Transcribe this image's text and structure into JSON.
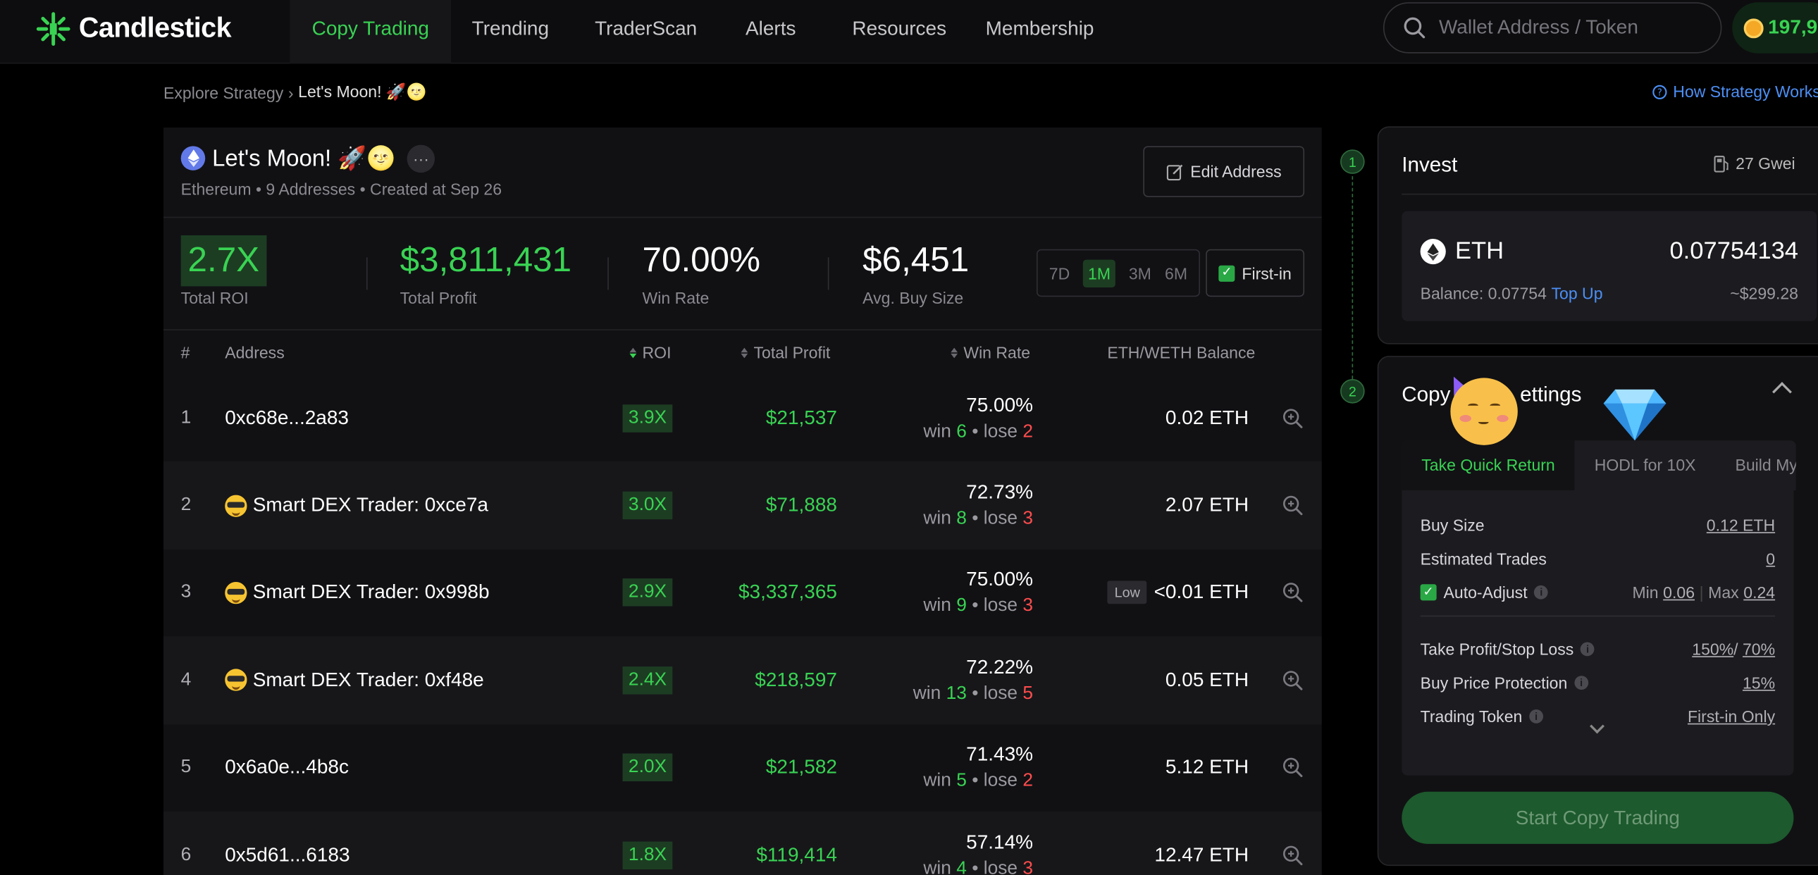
{
  "nav": {
    "logo": "Candlestick",
    "items": [
      "Copy Trading",
      "Trending",
      "TraderScan",
      "Alerts",
      "Resources",
      "Membership"
    ],
    "search_placeholder": "Wallet Address / Token",
    "points": "197,9",
    "accent": "#39d353"
  },
  "breadcrumb": {
    "parent": "Explore Strategy",
    "current": "Let's Moon! 🚀🌝"
  },
  "help_link": "How Strategy Works",
  "strategy": {
    "title": "Let's Moon! 🚀🌝",
    "more": "···",
    "subtitle": "Ethereum • 9 Addresses • Created at Sep 26",
    "edit_label": "Edit Address"
  },
  "stats": {
    "roi": {
      "value": "2.7X",
      "label": "Total ROI"
    },
    "profit": {
      "value": "$3,811,431",
      "label": "Total Profit"
    },
    "win_rate": {
      "value": "70.00%",
      "label": "Win Rate"
    },
    "buy_size": {
      "value": "$6,451",
      "label": "Avg. Buy Size"
    }
  },
  "periods": [
    "7D",
    "1M",
    "3M",
    "6M"
  ],
  "active_period": "1M",
  "first_in_label": "First-in",
  "table": {
    "headers": [
      "#",
      "Address",
      "ROI",
      "Total Profit",
      "Win Rate",
      "ETH/WETH Balance"
    ],
    "rows": [
      {
        "idx": "1",
        "address": "0xc68e...2a83",
        "emoji": false,
        "roi": "3.9X",
        "profit": "$21,537",
        "win_rate": "75.00%",
        "win": "6",
        "lose": "2",
        "low": "",
        "balance": "0.02 ETH"
      },
      {
        "idx": "2",
        "address": "Smart DEX Trader: 0xce7a",
        "emoji": true,
        "roi": "3.0X",
        "profit": "$71,888",
        "win_rate": "72.73%",
        "win": "8",
        "lose": "3",
        "low": "",
        "balance": "2.07 ETH"
      },
      {
        "idx": "3",
        "address": "Smart DEX Trader: 0x998b",
        "emoji": true,
        "roi": "2.9X",
        "profit": "$3,337,365",
        "win_rate": "75.00%",
        "win": "9",
        "lose": "3",
        "low": "Low",
        "balance": "<0.01 ETH"
      },
      {
        "idx": "4",
        "address": "Smart DEX Trader: 0xf48e",
        "emoji": true,
        "roi": "2.4X",
        "profit": "$218,597",
        "win_rate": "72.22%",
        "win": "13",
        "lose": "5",
        "low": "",
        "balance": "0.05 ETH"
      },
      {
        "idx": "5",
        "address": "0x6a0e...4b8c",
        "emoji": false,
        "roi": "2.0X",
        "profit": "$21,582",
        "win_rate": "71.43%",
        "win": "5",
        "lose": "2",
        "low": "",
        "balance": "5.12 ETH"
      },
      {
        "idx": "6",
        "address": "0x5d61...6183",
        "emoji": false,
        "roi": "1.8X",
        "profit": "$119,414",
        "win_rate": "57.14%",
        "win": "4",
        "lose": "3",
        "low": "",
        "balance": "12.47 ETH"
      }
    ],
    "win_word": "win",
    "lose_word": "lose",
    "dot": "•"
  },
  "invest": {
    "step": "1",
    "title": "Invest",
    "gas": "27 Gwei",
    "token": "ETH",
    "amount": "0.07754134",
    "balance_label": "Balance: 0.07754",
    "top_up": "Top Up",
    "usd": "~$299.28"
  },
  "settings": {
    "step": "2",
    "title": "Copy Trading Settings",
    "title_visible_start": "Copy",
    "title_visible_end": "ettings",
    "tabs": [
      "Take Quick Return",
      "HODL for 10X",
      "Build My"
    ],
    "buy_size": {
      "label": "Buy Size",
      "value": "0.12 ETH"
    },
    "est_trades": {
      "label": "Estimated Trades",
      "value": "0"
    },
    "auto_adjust": {
      "label": "Auto-Adjust",
      "min_label": "Min",
      "min": "0.06",
      "max_label": "Max",
      "max": "0.24"
    },
    "tp_sl": {
      "label": "Take Profit/Stop Loss",
      "tp": "150%",
      "sl": "70%"
    },
    "price_protection": {
      "label": "Buy Price Protection",
      "value": "15%"
    },
    "trading_token": {
      "label": "Trading Token",
      "value": "First-in Only"
    },
    "start_label": "Start Copy Trading"
  }
}
